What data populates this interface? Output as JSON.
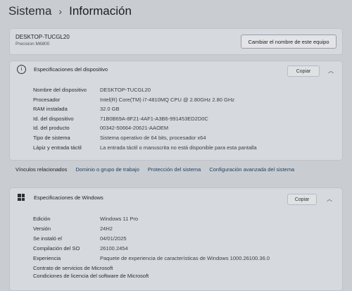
{
  "breadcrumb": {
    "parent": "Sistema",
    "separator": "›",
    "current": "Información"
  },
  "device": {
    "name": "DESKTOP-TUCGL20",
    "model": "Precision M6800",
    "rename_button": "Cambiar el nombre de este equipo"
  },
  "device_specs": {
    "title": "Especificaciones del dispositivo",
    "copy_label": "Copiar",
    "rows": [
      {
        "key": "Nombre del dispositivo",
        "value": "DESKTOP-TUCGL20"
      },
      {
        "key": "Procesador",
        "value": "Intel(R) Core(TM) i7-4810MQ CPU @ 2.80GHz   2.80 GHz"
      },
      {
        "key": "RAM instalada",
        "value": "32.0 GB"
      },
      {
        "key": "Id. del dispositivo",
        "value": "71B0B69A-8F21-4AF1-A3B6-991453ED2D0C"
      },
      {
        "key": "Id. del producto",
        "value": "00342-50664-20621-AAOEM"
      },
      {
        "key": "Tipo de sistema",
        "value": "Sistema operativo de 64 bits, procesador x64"
      },
      {
        "key": "Lápiz y entrada táctil",
        "value": "La entrada táctil o manuscrita no está disponible para esta pantalla"
      }
    ]
  },
  "related": {
    "label": "Vínculos relacionados",
    "links": [
      "Dominio o grupo de trabajo",
      "Protección del sistema",
      "Configuración avanzada del sistema"
    ]
  },
  "windows_specs": {
    "title": "Especificaciones de Windows",
    "copy_label": "Copiar",
    "rows": [
      {
        "key": "Edición",
        "value": "Windows 11 Pro"
      },
      {
        "key": "Versión",
        "value": "24H2"
      },
      {
        "key": "Se instaló el",
        "value": "04/01/2025"
      },
      {
        "key": "Compilación del SO",
        "value": "26100.2454"
      },
      {
        "key": "Experiencia",
        "value": "Paquete de experiencia de características de Windows 1000.26100.36.0"
      }
    ],
    "links": [
      "Contrato de servicios de Microsoft",
      "Condiciones de licencia del software de Microsoft"
    ]
  }
}
